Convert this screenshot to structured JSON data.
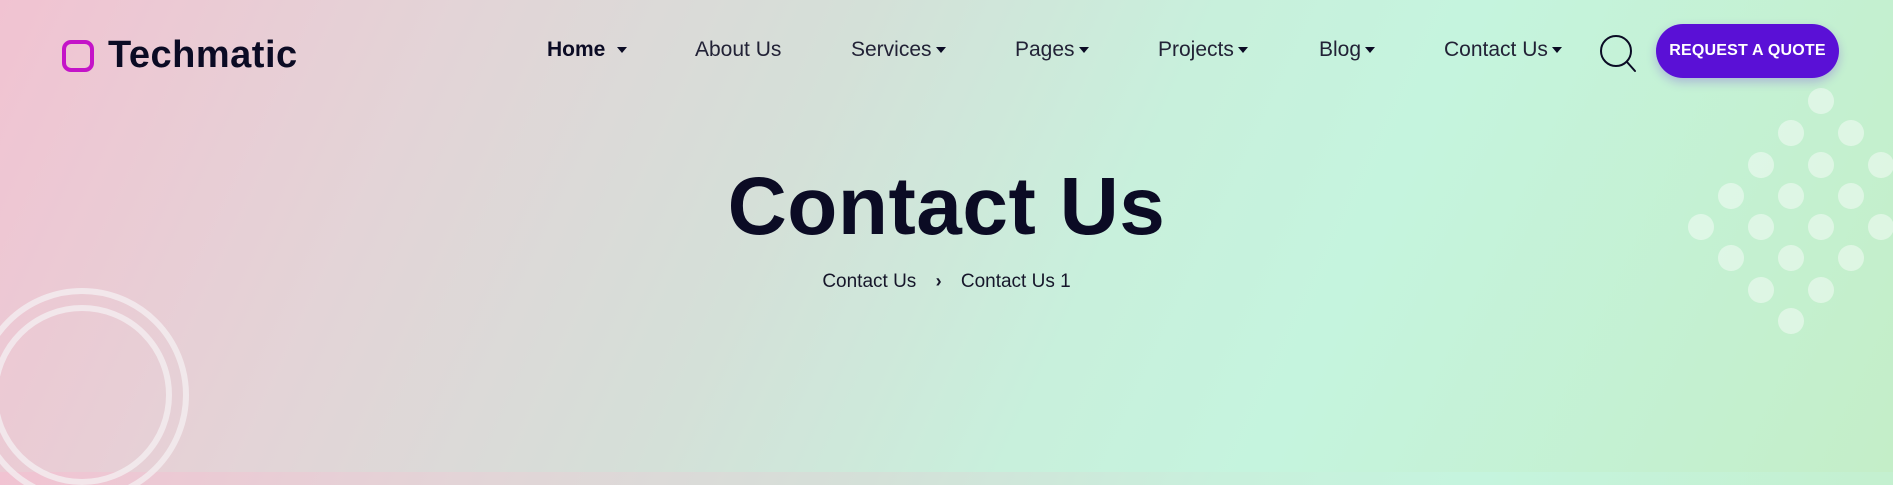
{
  "brand": {
    "name": "Techmatic",
    "accent_color": "#c414c8"
  },
  "nav": {
    "items": [
      {
        "label": "Home",
        "has_dropdown": true,
        "active": true
      },
      {
        "label": "About Us",
        "has_dropdown": false
      },
      {
        "label": "Services",
        "has_dropdown": true
      },
      {
        "label": "Pages",
        "has_dropdown": true
      },
      {
        "label": "Projects",
        "has_dropdown": true
      },
      {
        "label": "Blog",
        "has_dropdown": true
      },
      {
        "label": "Contact Us",
        "has_dropdown": true
      }
    ],
    "search_icon": "search-icon",
    "cta_label": "REQUEST A QUOTE",
    "cta_color": "#5a10d6"
  },
  "hero": {
    "title": "Contact Us",
    "breadcrumb": [
      "Contact Us",
      "Contact Us 1"
    ]
  }
}
